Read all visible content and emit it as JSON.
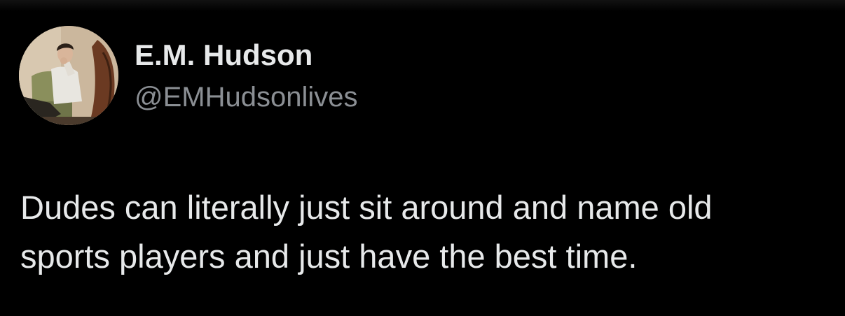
{
  "author": {
    "display_name": "E.M. Hudson",
    "handle": "@EMHudsonlives",
    "avatar_icon": "profile-photo"
  },
  "tweet": {
    "line_1": "Dudes can literally just sit around and name old",
    "line_2": "sports players and just have the best time."
  },
  "colors": {
    "background": "#000000",
    "primary_text": "#e7e9ea",
    "secondary_text": "#8b8f94"
  }
}
